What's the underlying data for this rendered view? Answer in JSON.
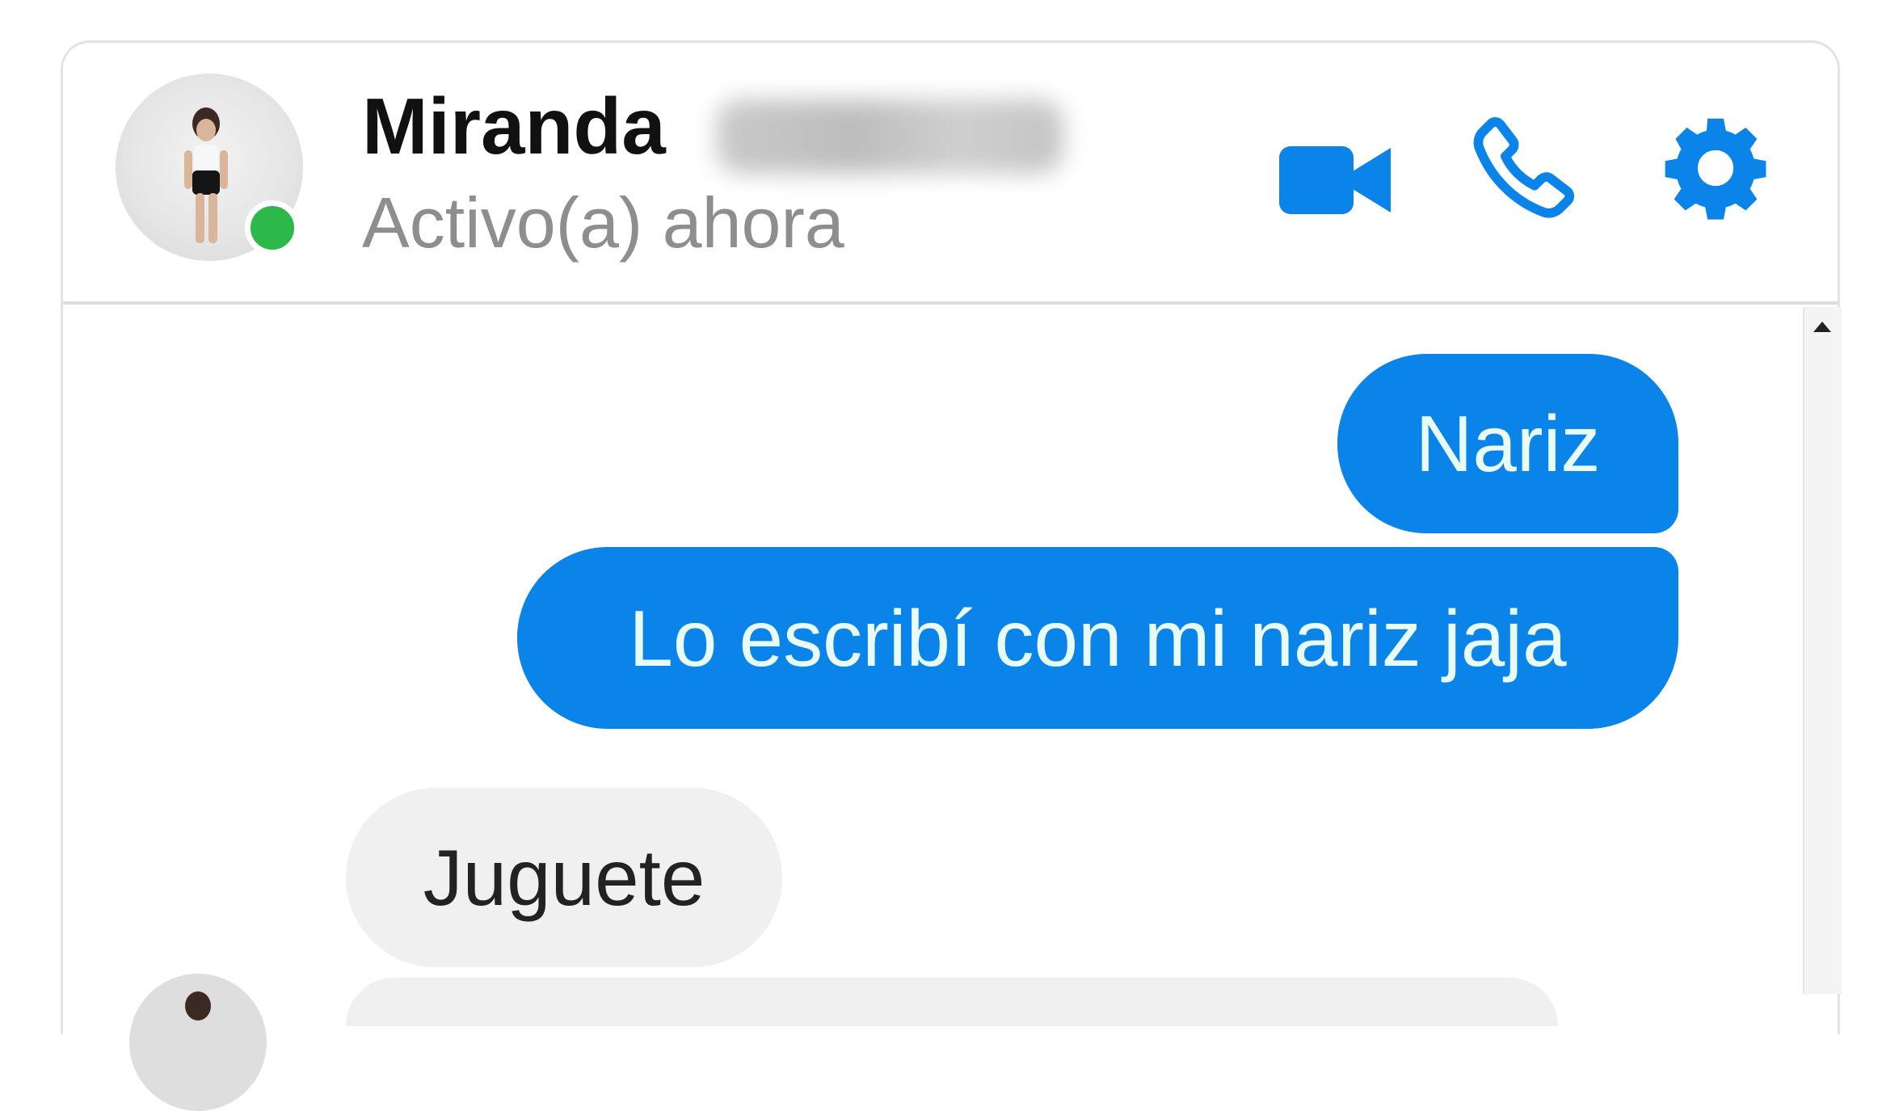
{
  "contact": {
    "name": "Miranda",
    "status": "Activo(a) ahora"
  },
  "colors": {
    "accent": "#0a84e8",
    "online": "#2db84a",
    "incoming_bubble": "#f0f0f0",
    "outgoing_text": "#e8fbf4"
  },
  "header_icons": [
    "video-camera-icon",
    "phone-icon",
    "gear-icon"
  ],
  "messages": [
    {
      "direction": "outgoing",
      "text": "Nariz"
    },
    {
      "direction": "outgoing",
      "text": "Lo escribí con mi nariz jaja"
    },
    {
      "direction": "incoming",
      "text": "Juguete"
    }
  ]
}
